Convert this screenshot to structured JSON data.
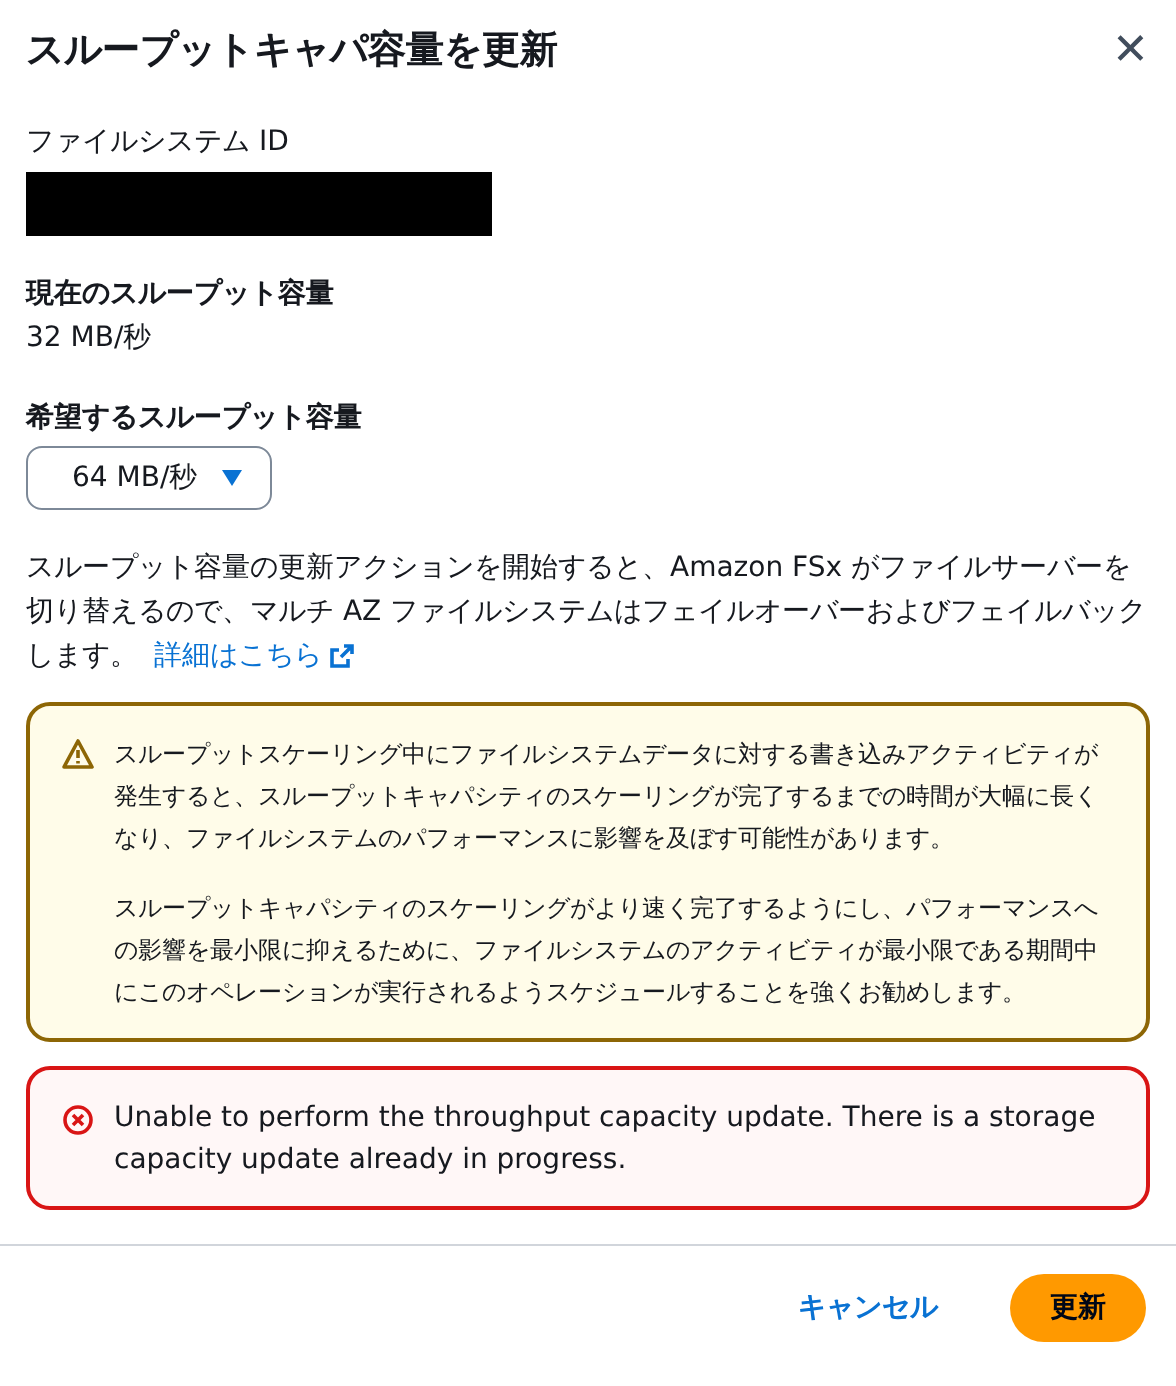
{
  "modal": {
    "title": "スループットキャパ容量を更新",
    "close_label": "✕"
  },
  "fields": [
    {
      "kind": "redacted",
      "label": "ファイルシステム ID"
    },
    {
      "kind": "value",
      "label": "現在のスループット容量",
      "value": "32 MB/秒"
    },
    {
      "kind": "select",
      "label": "希望するスループット容量",
      "value": "64 MB/秒"
    }
  ],
  "notice": {
    "text": "スループット容量の更新アクションを開始すると、Amazon FSx がファイルサーバーを切り替えるので、マルチ AZ ファイルシステムはフェイルオーバーおよびフェイルバックします。",
    "link": "詳細はこちら"
  },
  "alerts": [
    {
      "kind": "warning",
      "paragraphs": [
        "スループットスケーリング中にファイルシステムデータに対する書き込みアクティビティが発生すると、スループットキャパシティのスケーリングが完了するまでの時間が大幅に長くなり、ファイルシステムのパフォーマンスに影響を及ぼす可能性があります。",
        "スループットキャパシティのスケーリングがより速く完了するようにし、パフォーマンスへの影響を最小限に抑えるために、ファイルシステムのアクティビティが最小限である期間中にこのオペレーションが実行されるようスケジュールすることを強くお勧めします。"
      ]
    },
    {
      "kind": "error",
      "paragraphs": [
        "Unable to perform the throughput capacity update. There is a storage capacity update already in progress."
      ]
    }
  ],
  "buttons": [
    {
      "kind": "link",
      "label": "キャンセル"
    },
    {
      "kind": "primary",
      "label": "更新"
    }
  ]
}
